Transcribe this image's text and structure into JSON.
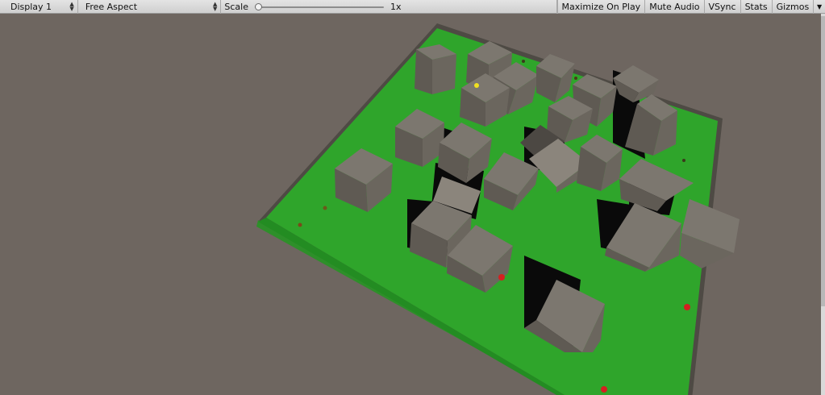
{
  "toolbar": {
    "display": "Display 1",
    "aspect": "Free Aspect",
    "scale_label": "Scale",
    "scale_value": "1x",
    "scale_level": 0.0,
    "maximize_on_play": "Maximize On Play",
    "mute_audio": "Mute Audio",
    "vsync": "VSync",
    "stats": "Stats",
    "gizmos": "Gizmos"
  },
  "icons": {
    "dropdown": "updown-arrows-icon",
    "gizmos_menu": "triangle-down-icon"
  },
  "colors": {
    "background": "#6e6660",
    "ground": "#2fa52b",
    "cube": "#6f6a62",
    "shadow": "#0a0a0a",
    "red_object": "#d42020",
    "yellow_object": "#f0e020"
  }
}
